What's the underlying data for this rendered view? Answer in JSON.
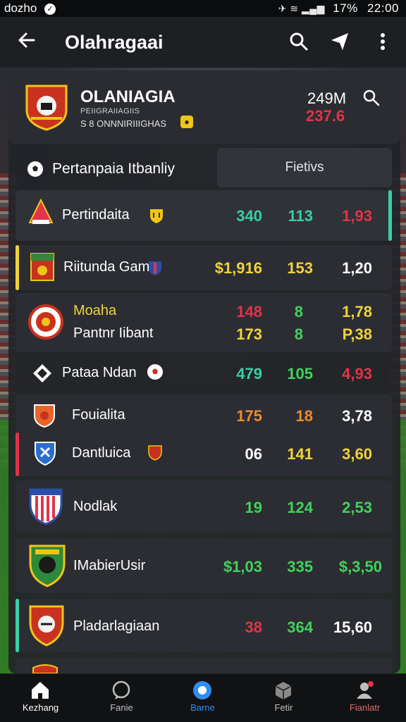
{
  "status_bar": {
    "left_text": "dozho",
    "right_text": "17%",
    "time": "22:00"
  },
  "app_bar": {
    "title": "Olahragaai"
  },
  "league": {
    "name": "OLANIAGIA",
    "subtitle": "PEIIGRAIIAGIIS",
    "tag": "S 8 ONNNIRIIIGHAS",
    "stat_value": "249M",
    "stat_change": "237.6"
  },
  "section": {
    "label": "Pertanpaia Itbanliy",
    "tab_label": "Fietivs"
  },
  "rows": [
    {
      "team": "Pertindaita",
      "v1": "340",
      "v2": "113",
      "v3": "1,93"
    },
    {
      "team": "Riitunda Gam",
      "v1": "$1,916",
      "v2": "153",
      "v3": "1,20"
    },
    {
      "team": "Moaha",
      "team2": "Pantnr Iibant",
      "v1": "148",
      "v1b": "173",
      "v2": "8",
      "v2b": "8",
      "v3": "1,78",
      "v3b": "P,38"
    },
    {
      "team": "Pataa Ndan",
      "v1": "479",
      "v2": "105",
      "v3": "4,93"
    },
    {
      "team": "Fouialita",
      "v1": "175",
      "v2": "18",
      "v3": "3,78"
    },
    {
      "team": "Dantluica",
      "v1": "06",
      "v2": "141",
      "v3": "3,60"
    },
    {
      "team": "Nodlak",
      "v1": "19",
      "v2": "124",
      "v3": "2,53"
    },
    {
      "team": "IMabierUsir",
      "v1": "$1,03",
      "v2": "335",
      "v3": "$,3,50"
    },
    {
      "team": "Pladarlagiaan",
      "v1": "38",
      "v2": "364",
      "v3": "15,60"
    }
  ],
  "bottom_nav": [
    {
      "label": "Kezhang",
      "icon": "home-icon",
      "color": "#ffffff"
    },
    {
      "label": "Fanie",
      "icon": "chat-icon",
      "color": "#bfbfbf"
    },
    {
      "label": "Barne",
      "icon": "ball-icon",
      "color": "#2e8ef0"
    },
    {
      "label": "Fetir",
      "icon": "box-icon",
      "color": "#bfbfbf"
    },
    {
      "label": "Fianlatr",
      "icon": "profile-icon",
      "color": "#e06a6a"
    }
  ],
  "colors": {
    "red": "#e3334a",
    "green": "#3fd45a",
    "teal": "#38cfa4",
    "yellow": "#f0d23c",
    "orange": "#f0892e"
  }
}
